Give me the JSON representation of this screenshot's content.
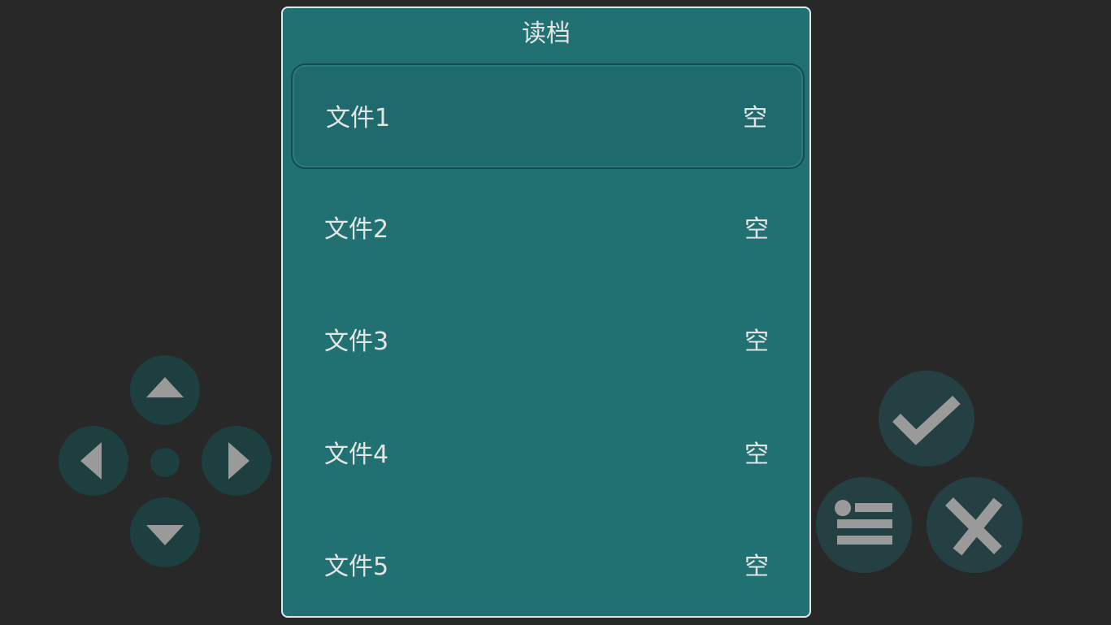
{
  "dialog": {
    "title": "读档",
    "slots": [
      {
        "name": "文件1",
        "status": "空",
        "selected": true
      },
      {
        "name": "文件2",
        "status": "空",
        "selected": false
      },
      {
        "name": "文件3",
        "status": "空",
        "selected": false
      },
      {
        "name": "文件4",
        "status": "空",
        "selected": false
      },
      {
        "name": "文件5",
        "status": "空",
        "selected": false
      }
    ]
  },
  "controls": {
    "dpad": [
      "arrow-up-icon",
      "arrow-left-icon",
      "arrow-right-icon",
      "arrow-down-icon"
    ],
    "actions": [
      "checkmark-icon",
      "menu-list-icon",
      "close-x-icon"
    ]
  },
  "colors": {
    "background": "#282828",
    "window": "#217173",
    "window_border": "#e6e6e6",
    "text": "#e4e4e4",
    "control": "#1d3f40",
    "control_glyph": "#9a9a9a"
  }
}
